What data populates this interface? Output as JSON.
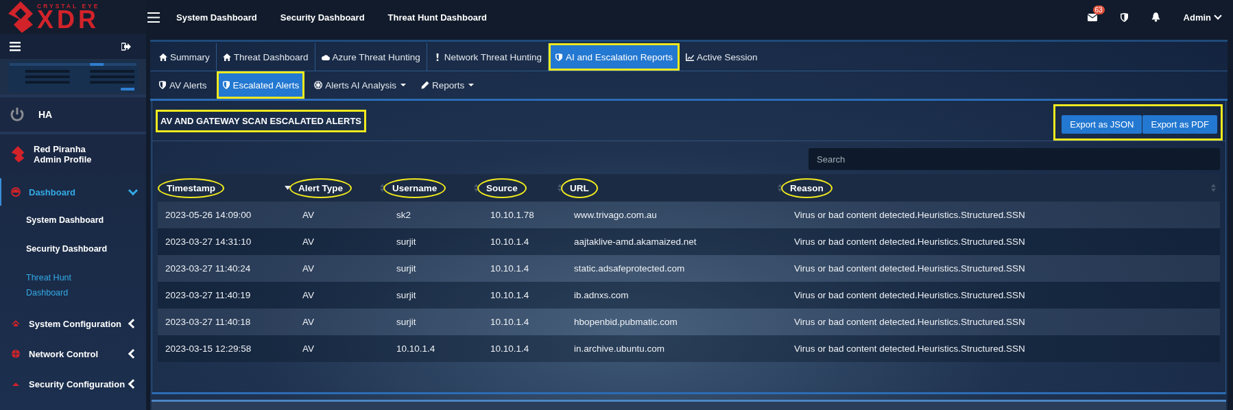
{
  "brand": {
    "tagline": "CRYSTAL EYE",
    "name": "XDR"
  },
  "top_nav": {
    "links": [
      "System Dashboard",
      "Security Dashboard",
      "Threat Hunt Dashboard"
    ],
    "mail_count": "63",
    "user": "Admin"
  },
  "sidebar": {
    "ha": "HA",
    "profile": {
      "name": "Red Piranha",
      "role": "Admin Profile"
    },
    "menu": [
      {
        "label": "Dashboard",
        "expanded": true,
        "selected": true,
        "children": [
          {
            "label": "System Dashboard",
            "selected": false
          },
          {
            "label": "Security Dashboard",
            "selected": false
          },
          {
            "label": "Threat Hunt Dashboard",
            "selected": true
          }
        ]
      },
      {
        "label": "System Configuration",
        "expanded": false,
        "selected": false
      },
      {
        "label": "Network Control",
        "expanded": false,
        "selected": false
      },
      {
        "label": "Security Configuration",
        "expanded": false,
        "selected": false
      }
    ]
  },
  "tabs": [
    {
      "label": "Summary",
      "selected": false,
      "highlighted": false
    },
    {
      "label": "Threat Dashboard",
      "selected": false,
      "highlighted": false
    },
    {
      "label": "Azure Threat Hunting",
      "selected": false,
      "highlighted": false
    },
    {
      "label": "Network Threat Hunting",
      "selected": false,
      "highlighted": false
    },
    {
      "label": "AI and Escalation Reports",
      "selected": true,
      "highlighted": true
    },
    {
      "label": "Active Session",
      "selected": false,
      "highlighted": false
    }
  ],
  "sub_tabs": [
    {
      "label": "AV Alerts",
      "selected": false,
      "highlighted": false,
      "dropdown": false
    },
    {
      "label": "Escalated Alerts",
      "selected": true,
      "highlighted": true,
      "dropdown": false
    },
    {
      "label": "Alerts AI Analysis",
      "selected": false,
      "highlighted": false,
      "dropdown": true
    },
    {
      "label": "Reports",
      "selected": false,
      "highlighted": false,
      "dropdown": true
    }
  ],
  "card": {
    "title": "AV AND GATEWAY SCAN ESCALATED ALERTS",
    "title_highlighted": true,
    "buttons": [
      "Export as JSON",
      "Export as PDF"
    ],
    "buttons_highlighted": true,
    "search": {
      "placeholder": "Search"
    },
    "columns": [
      {
        "label": "Timestamp",
        "highlighted": true,
        "sorted": true
      },
      {
        "label": "Alert Type",
        "highlighted": true,
        "sorted": false
      },
      {
        "label": "Username",
        "highlighted": true,
        "sorted": false
      },
      {
        "label": "Source",
        "highlighted": true,
        "sorted": false
      },
      {
        "label": "URL",
        "highlighted": true,
        "sorted": false
      },
      {
        "label": "Reason",
        "highlighted": true,
        "sorted": false
      }
    ],
    "rows": [
      [
        "2023-05-26 14:09:00",
        "AV",
        "sk2",
        "10.10.1.78",
        "www.trivago.com.au",
        "Virus or bad content detected.Heuristics.Structured.SSN"
      ],
      [
        "2023-03-27 14:31:10",
        "AV",
        "surjit",
        "10.10.1.4",
        "aajtaklive-amd.akamaized.net",
        "Virus or bad content detected.Heuristics.Structured.SSN"
      ],
      [
        "2023-03-27 11:40:24",
        "AV",
        "surjit",
        "10.10.1.4",
        "static.adsafeprotected.com",
        "Virus or bad content detected.Heuristics.Structured.SSN"
      ],
      [
        "2023-03-27 11:40:19",
        "AV",
        "surjit",
        "10.10.1.4",
        "ib.adnxs.com",
        "Virus or bad content detected.Heuristics.Structured.SSN"
      ],
      [
        "2023-03-27 11:40:18",
        "AV",
        "surjit",
        "10.10.1.4",
        "hbopenbid.pubmatic.com",
        "Virus or bad content detected.Heuristics.Structured.SSN"
      ],
      [
        "2023-03-15 12:29:58",
        "AV",
        "10.10.1.4",
        "10.10.1.4",
        "in.archive.ubuntu.com",
        "Virus or bad content detected.Heuristics.Structured.SSN"
      ]
    ]
  }
}
